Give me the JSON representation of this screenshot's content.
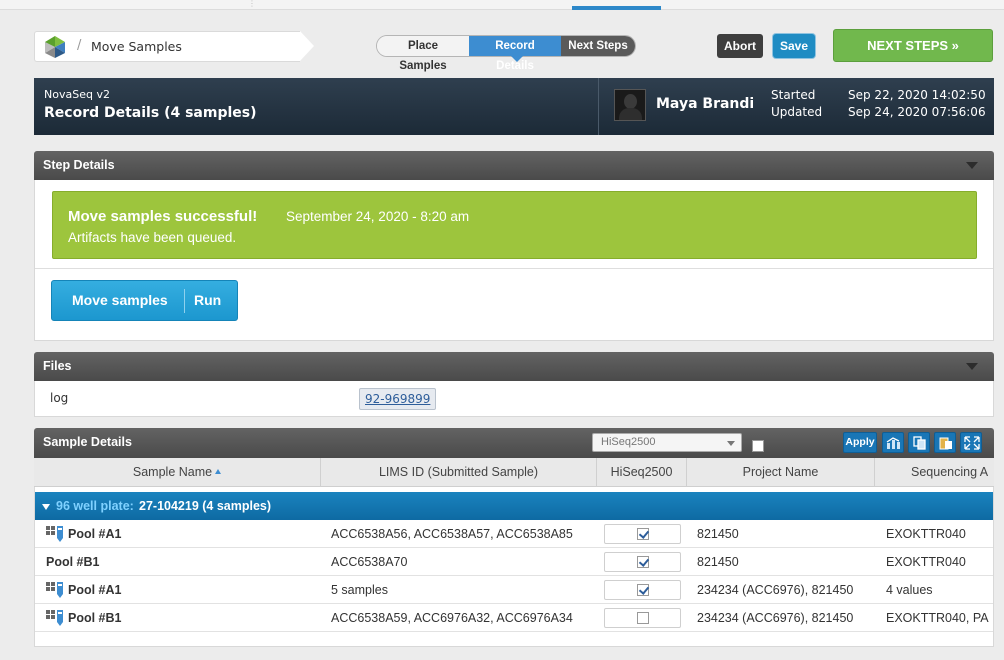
{
  "header": {
    "breadcrumb_sep": "/",
    "page_title": "Move Samples",
    "steps": [
      "Place Samples",
      "Record Details",
      "Next Steps"
    ],
    "active_step": "Record Details",
    "abort_label": "Abort",
    "save_label": "Save",
    "next_steps_label": "NEXT STEPS »"
  },
  "banner": {
    "protocol": "NovaSeq v2",
    "title": "Record Details",
    "sample_count": "(4 samples)",
    "user": "Maya Brandi",
    "started_label": "Started",
    "updated_label": "Updated",
    "started": "Sep 22, 2020 14:02:50",
    "updated": "Sep 24, 2020 07:56:06"
  },
  "step_details": {
    "title": "Step Details",
    "success_main": "Move samples successful!",
    "success_when": "September 24, 2020 - 8:20 am",
    "success_sub": "Artifacts have been queued.",
    "run_label": "Move samples",
    "run_action": "Run"
  },
  "files": {
    "title": "Files",
    "key": "log",
    "value": "92-969899"
  },
  "sample_details": {
    "title": "Sample Details",
    "selected_field": "HiSeq2500",
    "apply_label": "Apply",
    "columns": [
      "Sample Name",
      "LIMS ID (Submitted Sample)",
      "HiSeq2500",
      "Project Name",
      "Sequencing A"
    ],
    "group": {
      "label": "96 well plate:",
      "value": "27-104219 (4 samples)"
    },
    "rows": [
      {
        "name": "Pool #A1",
        "lims": "ACC6538A56, ACC6538A57, ACC6538A85",
        "checked": true,
        "project": "821450",
        "seq": "EXOKTTR040"
      },
      {
        "name": "Pool #B1",
        "lims": "ACC6538A70",
        "checked": true,
        "project": "821450",
        "seq": "EXOKTTR040"
      },
      {
        "name": "Pool #A1",
        "lims": "5 samples",
        "checked": true,
        "project": "234234 (ACC6976), 821450",
        "seq": "4 values"
      },
      {
        "name": "Pool #B1",
        "lims": "ACC6538A59, ACC6976A32, ACC6976A34",
        "checked": false,
        "project": "234234 (ACC6976), 821450",
        "seq": "EXOKTTR040, PA"
      }
    ]
  },
  "colors": {
    "accent_blue": "#3d8dd1",
    "success_green": "#9dc53d",
    "next_green": "#71b84d",
    "banner_navy": "#1c2a37"
  }
}
